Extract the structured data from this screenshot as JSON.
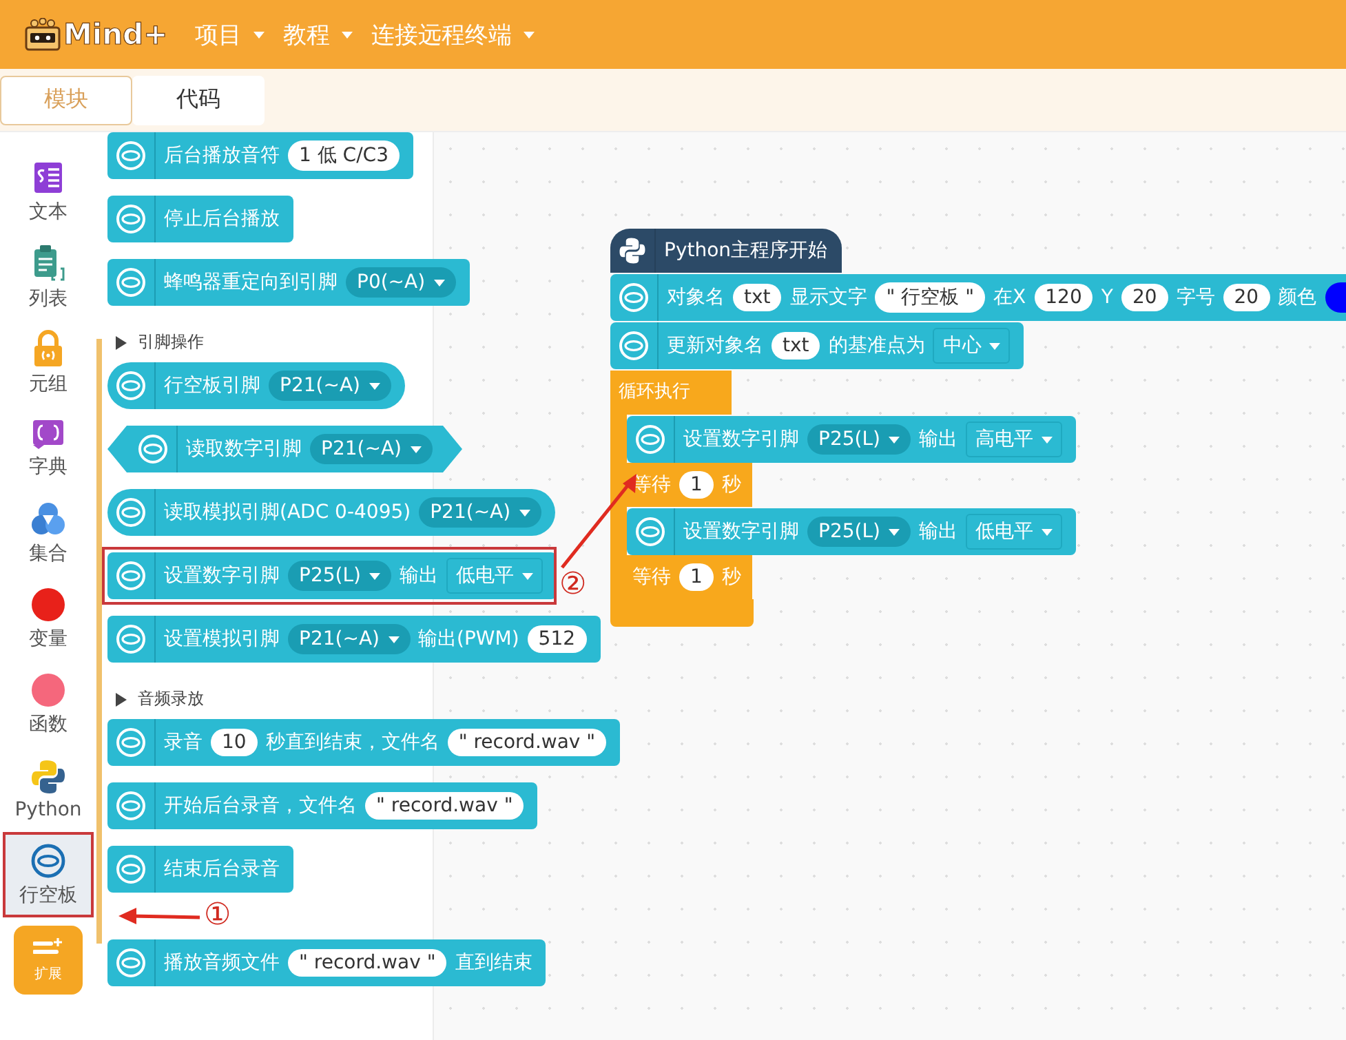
{
  "header": {
    "logo": "Mind+",
    "menus": [
      {
        "label": "项目"
      },
      {
        "label": "教程"
      },
      {
        "label": "连接远程终端"
      }
    ]
  },
  "tabs": [
    {
      "label": "模块",
      "selected": true
    },
    {
      "label": "代码",
      "selected": false
    }
  ],
  "sidebar": {
    "items": [
      {
        "label": "文本",
        "selected": false,
        "highlighted": false
      },
      {
        "label": "列表",
        "selected": false,
        "highlighted": false
      },
      {
        "label": "元组",
        "selected": false,
        "highlighted": false
      },
      {
        "label": "字典",
        "selected": false,
        "highlighted": false
      },
      {
        "label": "集合",
        "selected": false,
        "highlighted": false
      },
      {
        "label": "变量",
        "selected": false,
        "highlighted": false
      },
      {
        "label": "函数",
        "selected": false,
        "highlighted": false
      },
      {
        "label": "Python",
        "selected": false,
        "highlighted": false
      },
      {
        "label": "行空板",
        "selected": true,
        "highlighted": true
      }
    ],
    "extension_button": "扩展"
  },
  "palette": [
    {
      "kind": "stack",
      "segments": [
        {
          "kind": "text",
          "text": "后台播放音符"
        },
        {
          "kind": "input",
          "text": "1 低 C/C3"
        }
      ]
    },
    {
      "kind": "stack",
      "segments": [
        {
          "kind": "text",
          "text": "停止后台播放"
        }
      ]
    },
    {
      "kind": "stack",
      "segments": [
        {
          "kind": "text",
          "text": "蜂鸣器重定向到引脚"
        },
        {
          "kind": "dropdown",
          "text": "P0(~A)"
        }
      ]
    },
    {
      "kind": "label",
      "text": "引脚操作"
    },
    {
      "kind": "reporter",
      "segments": [
        {
          "kind": "text",
          "text": "行空板引脚"
        },
        {
          "kind": "dropdown",
          "text": "P21(~A)"
        }
      ]
    },
    {
      "kind": "boolean",
      "segments": [
        {
          "kind": "text",
          "text": "读取数字引脚"
        },
        {
          "kind": "dropdown",
          "text": "P21(~A)"
        }
      ]
    },
    {
      "kind": "reporter",
      "segments": [
        {
          "kind": "text",
          "text": "读取模拟引脚(ADC 0-4095)"
        },
        {
          "kind": "dropdown",
          "text": "P21(~A)"
        }
      ]
    },
    {
      "kind": "stack",
      "segments": [
        {
          "kind": "text",
          "text": "设置数字引脚"
        },
        {
          "kind": "dropdown",
          "text": "P25(L)"
        },
        {
          "kind": "text",
          "text": "输出"
        },
        {
          "kind": "menu",
          "text": "低电平"
        }
      ]
    },
    {
      "kind": "stack",
      "segments": [
        {
          "kind": "text",
          "text": "设置模拟引脚"
        },
        {
          "kind": "dropdown",
          "text": "P21(~A)"
        },
        {
          "kind": "text",
          "text": "输出(PWM)"
        },
        {
          "kind": "input",
          "text": "512"
        }
      ]
    },
    {
      "kind": "label",
      "text": "音频录放"
    },
    {
      "kind": "stack",
      "segments": [
        {
          "kind": "text",
          "text": "录音"
        },
        {
          "kind": "input",
          "text": "10"
        },
        {
          "kind": "text",
          "text": "秒直到结束，文件名"
        },
        {
          "kind": "input",
          "text": "\" record.wav \""
        }
      ]
    },
    {
      "kind": "stack",
      "segments": [
        {
          "kind": "text",
          "text": "开始后台录音，文件名"
        },
        {
          "kind": "input",
          "text": "\" record.wav \""
        }
      ]
    },
    {
      "kind": "stack",
      "segments": [
        {
          "kind": "text",
          "text": "结束后台录音"
        }
      ]
    },
    {
      "kind": "stack",
      "segments": [
        {
          "kind": "text",
          "text": "播放音频文件"
        },
        {
          "kind": "input",
          "text": "\" record.wav \""
        },
        {
          "kind": "text",
          "text": "直到结束"
        }
      ]
    }
  ],
  "script": [
    {
      "kind": "hat",
      "text": "Python主程序开始"
    },
    {
      "kind": "block",
      "segments": [
        {
          "kind": "text",
          "text": "对象名"
        },
        {
          "kind": "input",
          "text": "txt"
        },
        {
          "kind": "text",
          "text": "显示文字"
        },
        {
          "kind": "input",
          "text": "\" 行空板 \""
        },
        {
          "kind": "text",
          "text": "在X"
        },
        {
          "kind": "input",
          "text": "120"
        },
        {
          "kind": "text",
          "text": "Y"
        },
        {
          "kind": "input",
          "text": "20"
        },
        {
          "kind": "text",
          "text": "字号"
        },
        {
          "kind": "input",
          "text": "20"
        },
        {
          "kind": "text",
          "text": "颜色"
        },
        {
          "kind": "color",
          "color": "#0000ff"
        }
      ]
    },
    {
      "kind": "block",
      "segments": [
        {
          "kind": "text",
          "text": "更新对象名"
        },
        {
          "kind": "input",
          "text": "txt"
        },
        {
          "kind": "text",
          "text": "的基准点为"
        },
        {
          "kind": "menu",
          "text": "中心"
        }
      ]
    },
    {
      "kind": "loop",
      "text": "循环执行",
      "children": [
        {
          "kind": "block",
          "segments": [
            {
              "kind": "text",
              "text": "设置数字引脚"
            },
            {
              "kind": "dropdown",
              "text": "P25(L)"
            },
            {
              "kind": "text",
              "text": "输出"
            },
            {
              "kind": "menu",
              "text": "高电平"
            }
          ]
        },
        {
          "kind": "wait",
          "segments": [
            {
              "kind": "text",
              "text": "等待"
            },
            {
              "kind": "input",
              "text": "1"
            },
            {
              "kind": "text",
              "text": "秒"
            }
          ]
        },
        {
          "kind": "block",
          "segments": [
            {
              "kind": "text",
              "text": "设置数字引脚"
            },
            {
              "kind": "dropdown",
              "text": "P25(L)"
            },
            {
              "kind": "text",
              "text": "输出"
            },
            {
              "kind": "menu",
              "text": "低电平"
            }
          ]
        },
        {
          "kind": "wait",
          "segments": [
            {
              "kind": "text",
              "text": "等待"
            },
            {
              "kind": "input",
              "text": "1"
            },
            {
              "kind": "text",
              "text": "秒"
            }
          ]
        }
      ]
    }
  ],
  "annotations": [
    {
      "kind": "frame"
    },
    {
      "kind": "number",
      "label": "①"
    },
    {
      "kind": "number",
      "label": "②"
    }
  ]
}
